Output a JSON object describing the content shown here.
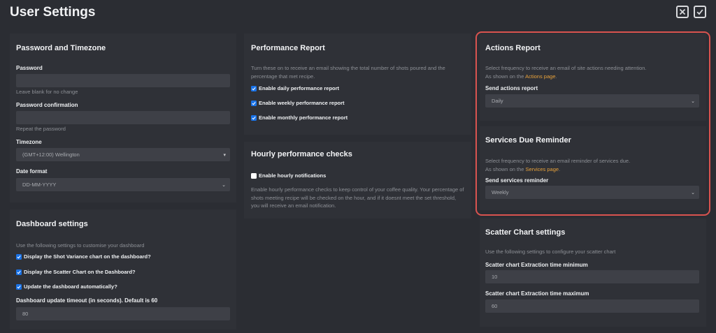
{
  "page": {
    "title": "User Settings"
  },
  "top_icons": {
    "close": "x-box-icon",
    "confirm": "check-box-icon"
  },
  "password_timezone": {
    "title": "Password and Timezone",
    "password_label": "Password",
    "password_value": "",
    "password_help": "Leave blank for no change",
    "confirm_label": "Password confirmation",
    "confirm_value": "",
    "confirm_help": "Repeat the password",
    "timezone_label": "Timezone",
    "timezone_value": "(GMT+12:00) Wellington",
    "date_format_label": "Date format",
    "date_format_value": "DD-MM-YYYY"
  },
  "dashboard": {
    "title": "Dashboard settings",
    "description": "Use the following settings to customise your dashboard",
    "options": [
      {
        "label": "Display the Shot Variance chart on the dashboard?",
        "checked": true
      },
      {
        "label": "Display the Scatter Chart on the Dashboard?",
        "checked": true
      },
      {
        "label": "Update the dashboard automatically?",
        "checked": true
      }
    ],
    "timeout_label": "Dashboard update timeout (in seconds). Default is 60",
    "timeout_value": "80"
  },
  "performance": {
    "title": "Performance Report",
    "description": "Turn these on to receive an email showing the total number of shots poured and the percentage that met recipe.",
    "options": [
      {
        "label": "Enable daily performance report",
        "checked": true
      },
      {
        "label": "Enable weekly performance report",
        "checked": true
      },
      {
        "label": "Enable monthly performance report",
        "checked": true
      }
    ]
  },
  "hourly": {
    "title": "Hourly performance checks",
    "option": {
      "label": "Enable hourly notifications",
      "checked": false
    },
    "description": "Enable hourly performance checks to keep control of your coffee quality. Your percentage of shots meeting recipe will be checked on the hour, and if it doesnt meet the set threshold, you will receive an email notification."
  },
  "actions": {
    "title": "Actions Report",
    "desc_line1": "Select frequency to receive an email of site actions needing attention.",
    "desc_prefix": "As shown on the ",
    "desc_link": "Actions page",
    "desc_suffix": ".",
    "send_label": "Send actions report",
    "send_value": "Daily"
  },
  "services": {
    "title": "Services Due Reminder",
    "desc_line1": "Select frequency to receive an email reminder of services due.",
    "desc_prefix": "As shown on the ",
    "desc_link": "Services page",
    "desc_suffix": ".",
    "send_label": "Send services reminder",
    "send_value": "Weekly"
  },
  "scatter": {
    "title": "Scatter Chart settings",
    "description": "Use the following settings to configure your scatter chart",
    "min_label": "Scatter chart Extraction time minimum",
    "min_value": "10",
    "max_label": "Scatter chart Extraction time maximum",
    "max_value": "60"
  },
  "colors": {
    "background": "#2b2d33",
    "panel": "#2f3137",
    "input": "#3e4047",
    "link": "#e8a23b",
    "checkbox": "#1a73e8",
    "highlight": "#d9534f"
  }
}
